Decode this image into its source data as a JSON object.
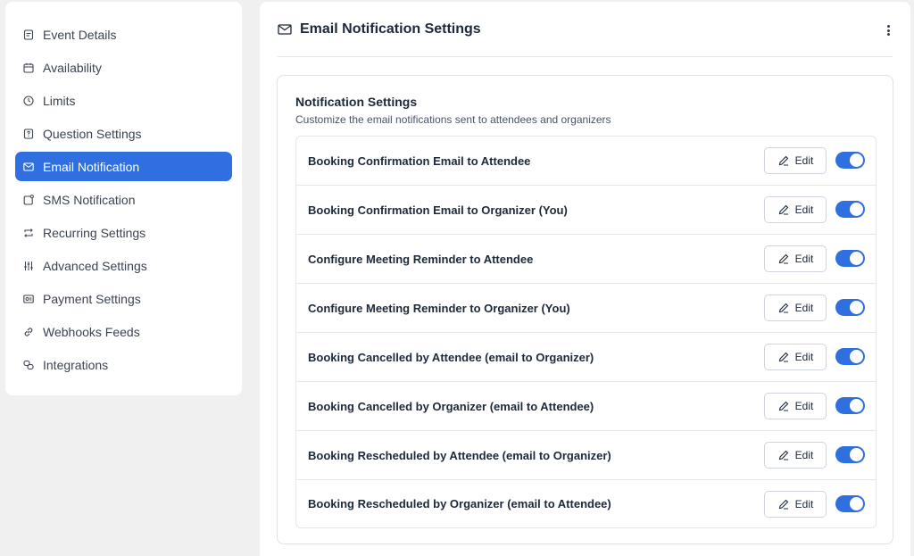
{
  "sidebar": {
    "items": [
      {
        "label": "Event Details",
        "icon": "document-icon"
      },
      {
        "label": "Availability",
        "icon": "calendar-icon"
      },
      {
        "label": "Limits",
        "icon": "clock-icon"
      },
      {
        "label": "Question Settings",
        "icon": "question-icon"
      },
      {
        "label": "Email Notification",
        "icon": "mail-icon",
        "active": true
      },
      {
        "label": "SMS Notification",
        "icon": "sms-icon"
      },
      {
        "label": "Recurring Settings",
        "icon": "repeat-icon"
      },
      {
        "label": "Advanced Settings",
        "icon": "sliders-icon"
      },
      {
        "label": "Payment Settings",
        "icon": "payment-icon"
      },
      {
        "label": "Webhooks Feeds",
        "icon": "link-icon"
      },
      {
        "label": "Integrations",
        "icon": "integrations-icon"
      }
    ]
  },
  "main": {
    "title": "Email Notification Settings",
    "card": {
      "title": "Notification Settings",
      "subtitle": "Customize the email notifications sent to attendees and organizers",
      "edit_label": "Edit",
      "rows": [
        {
          "label": "Booking Confirmation Email to Attendee",
          "enabled": true
        },
        {
          "label": "Booking Confirmation Email to Organizer (You)",
          "enabled": true
        },
        {
          "label": "Configure Meeting Reminder to Attendee",
          "enabled": true
        },
        {
          "label": "Configure Meeting Reminder to Organizer (You)",
          "enabled": true
        },
        {
          "label": "Booking Cancelled by Attendee (email to Organizer)",
          "enabled": true
        },
        {
          "label": "Booking Cancelled by Organizer (email to Attendee)",
          "enabled": true
        },
        {
          "label": "Booking Rescheduled by Attendee (email to Organizer)",
          "enabled": true
        },
        {
          "label": "Booking Rescheduled by Organizer (email to Attendee)",
          "enabled": true
        }
      ]
    }
  },
  "colors": {
    "accent": "#2f6fdf",
    "background": "#f0f0f1",
    "panel": "#ffffff"
  }
}
